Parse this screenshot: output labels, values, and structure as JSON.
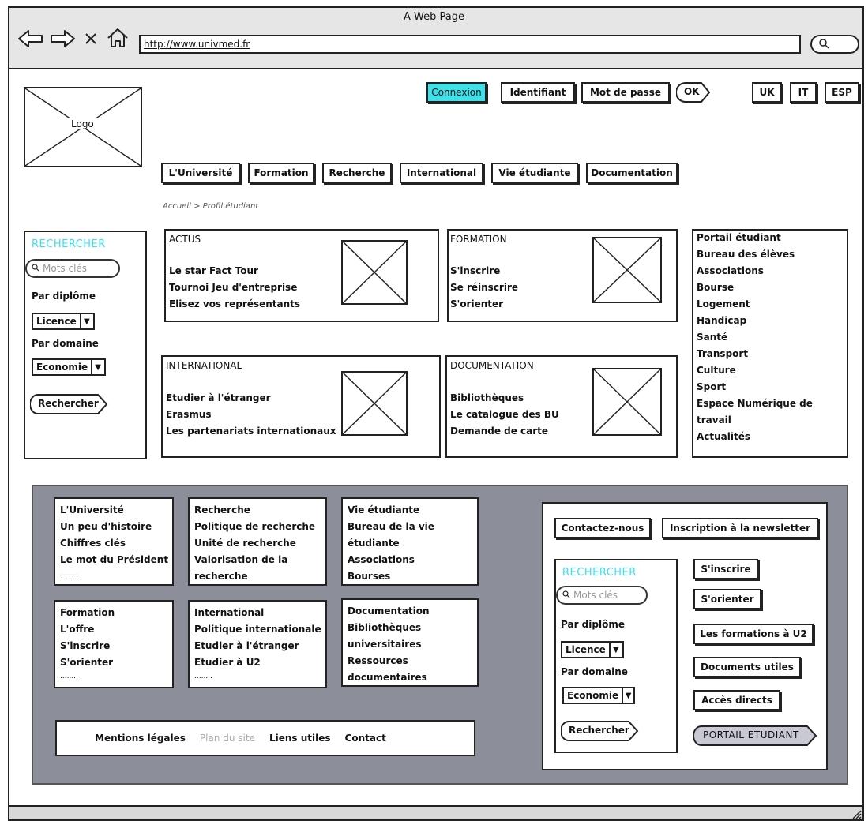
{
  "browser": {
    "title": "A Web Page",
    "url": "http://www.univmed.fr",
    "nav_icons": [
      "back-arrow-icon",
      "forward-arrow-icon",
      "close-icon",
      "home-icon"
    ],
    "search_icon": "search-icon"
  },
  "header": {
    "logo_label": "Logo",
    "login": {
      "connexion": "Connexion",
      "identifiant": "Identifiant",
      "password": "Mot de passe",
      "ok": "OK"
    },
    "languages": [
      "UK",
      "IT",
      "ESP"
    ],
    "menu": [
      "L'Université",
      "Formation",
      "Recherche",
      "International",
      "Vie étudiante",
      "Documentation"
    ],
    "breadcrumb": "Accueil > Profil étudiant"
  },
  "search_panel": {
    "title": "RECHERCHER",
    "placeholder": "Mots clés",
    "by_degree_label": "Par diplôme",
    "degree_value": "Licence",
    "by_domain_label": "Par domaine",
    "domain_value": "Economie",
    "button": "Rechercher"
  },
  "blocks": {
    "actus": {
      "title": "ACTUS",
      "items": [
        "Le star Fact Tour",
        "Tournoi Jeu d'entreprise",
        "Elisez vos représentants"
      ]
    },
    "formation": {
      "title": "FORMATION",
      "items": [
        "S'inscrire",
        "Se réinscrire",
        "S'orienter"
      ]
    },
    "international": {
      "title": "INTERNATIONAL",
      "items": [
        "Etudier à l'étranger",
        "Erasmus",
        "Les partenariats internationaux"
      ]
    },
    "documentation": {
      "title": "DOCUMENTATION",
      "items": [
        "Bibliothèques",
        "Le catalogue des BU",
        "Demande de carte"
      ]
    }
  },
  "portal_list": [
    "Portail étudiant",
    "Bureau des élèves",
    "Associations",
    "Bourse",
    "Logement",
    "Handicap",
    "Santé",
    "Transport",
    "Culture",
    "Sport",
    "Espace Numérique de",
    "travail",
    "Actualités"
  ],
  "footer": {
    "col_boxes": [
      [
        "L'Université",
        "Un peu d'histoire",
        "Chiffres clés",
        "Le mot du Président",
        "........"
      ],
      [
        "Recherche",
        "Politique de recherche",
        "Unité de recherche",
        "Valorisation de la",
        "recherche"
      ],
      [
        "Vie étudiante",
        "Bureau de la vie",
        "étudiante",
        "Associations",
        "Bourses"
      ],
      [
        "Formation",
        "L'offre",
        "S'inscrire",
        "S'orienter",
        "........"
      ],
      [
        "International",
        "Politique internationale",
        "Etudier à l'étranger",
        "Etudier à U2",
        "........"
      ],
      [
        "Documentation",
        "Bibliothèques",
        "universitaires",
        "Ressources",
        "documentaires"
      ]
    ],
    "links": {
      "legal": "Mentions légales",
      "sitemap": "Plan du site",
      "useful": "Liens utiles",
      "contact": "Contact"
    },
    "right": {
      "contact_btn": "Contactez-nous",
      "newsletter_btn": "Inscription à la newsletter",
      "search": {
        "title": "RECHERCHER",
        "placeholder": "Mots clés",
        "by_degree_label": "Par diplôme",
        "degree_value": "Licence",
        "by_domain_label": "Par domaine",
        "domain_value": "Economie",
        "button": "Rechercher"
      },
      "buttons": [
        "S'inscrire",
        "S'orienter",
        "Les formations à U2",
        "Documents utiles",
        "Accès directs"
      ],
      "portal_btn": "PORTAIL ETUDIANT"
    }
  }
}
